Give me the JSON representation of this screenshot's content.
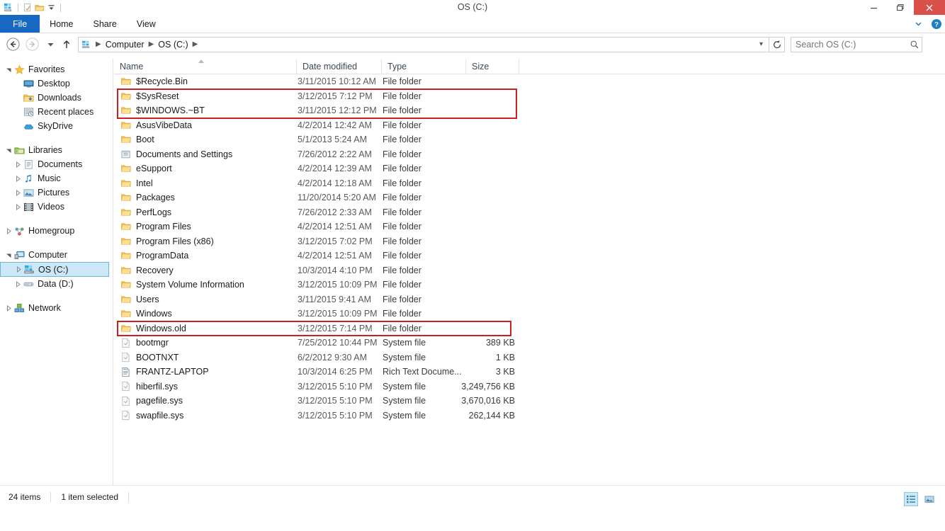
{
  "window": {
    "title": "OS (C:)",
    "quick_access": [
      "explorer-icon",
      "properties-icon",
      "new-folder-icon",
      "customize-dropdown-icon"
    ],
    "controls": {
      "minimize": "minimize-icon",
      "maximize": "restore-icon",
      "close": "close-icon"
    }
  },
  "ribbon": {
    "tabs": [
      {
        "label": "File",
        "active": true
      },
      {
        "label": "Home",
        "active": false
      },
      {
        "label": "Share",
        "active": false
      },
      {
        "label": "View",
        "active": false
      }
    ],
    "collapse_icon": "chevron-down-icon",
    "help_icon": "help-icon"
  },
  "address": {
    "back_icon": "back-arrow-icon",
    "forward_icon": "forward-arrow-icon",
    "history_icon": "recent-locations-icon",
    "up_icon": "up-arrow-icon",
    "breadcrumbs": [
      "Computer",
      "OS (C:)"
    ],
    "refresh_icon": "refresh-icon",
    "dropdown_icon": "chevron-down-icon"
  },
  "search": {
    "placeholder": "Search OS (C:)",
    "value": "",
    "icon": "search-icon"
  },
  "sidebar": {
    "groups": [
      {
        "header": {
          "label": "Favorites",
          "icon": "star-icon",
          "expander": "expanded"
        },
        "items": [
          {
            "label": "Desktop",
            "icon": "desktop-icon",
            "expander": "none"
          },
          {
            "label": "Downloads",
            "icon": "downloads-folder-icon",
            "expander": "none"
          },
          {
            "label": "Recent places",
            "icon": "recent-places-icon",
            "expander": "none"
          },
          {
            "label": "SkyDrive",
            "icon": "skydrive-cloud-icon",
            "expander": "none"
          }
        ]
      },
      {
        "header": {
          "label": "Libraries",
          "icon": "libraries-icon",
          "expander": "expanded"
        },
        "items": [
          {
            "label": "Documents",
            "icon": "documents-library-icon",
            "expander": "collapsed"
          },
          {
            "label": "Music",
            "icon": "music-note-icon",
            "expander": "collapsed"
          },
          {
            "label": "Pictures",
            "icon": "pictures-icon",
            "expander": "collapsed"
          },
          {
            "label": "Videos",
            "icon": "videos-icon",
            "expander": "collapsed"
          }
        ]
      },
      {
        "header": {
          "label": "Homegroup",
          "icon": "homegroup-icon",
          "expander": "collapsed"
        },
        "items": []
      },
      {
        "header": {
          "label": "Computer",
          "icon": "computer-icon",
          "expander": "expanded"
        },
        "items": [
          {
            "label": "OS (C:)",
            "icon": "hard-drive-icon",
            "expander": "collapsed",
            "selected": true
          },
          {
            "label": "Data (D:)",
            "icon": "disk-drive-icon",
            "expander": "collapsed"
          }
        ]
      },
      {
        "header": {
          "label": "Network",
          "icon": "network-icon",
          "expander": "collapsed"
        },
        "items": []
      }
    ]
  },
  "filelist": {
    "columns": [
      {
        "label": "Name",
        "sorted": "asc"
      },
      {
        "label": "Date modified",
        "sorted": "none"
      },
      {
        "label": "Type",
        "sorted": "none"
      },
      {
        "label": "Size",
        "sorted": "none"
      }
    ],
    "rows": [
      {
        "name": "$Recycle.Bin",
        "date": "3/11/2015 10:12 AM",
        "type": "File folder",
        "size": "",
        "icon": "folder-icon",
        "highlighted": false
      },
      {
        "name": "$SysReset",
        "date": "3/12/2015 7:12 PM",
        "type": "File folder",
        "size": "",
        "icon": "folder-icon",
        "highlighted": true
      },
      {
        "name": "$WINDOWS.~BT",
        "date": "3/11/2015 12:12 PM",
        "type": "File folder",
        "size": "",
        "icon": "folder-icon",
        "highlighted": true
      },
      {
        "name": "AsusVibeData",
        "date": "4/2/2014 12:42 AM",
        "type": "File folder",
        "size": "",
        "icon": "folder-icon",
        "highlighted": false
      },
      {
        "name": "Boot",
        "date": "5/1/2013 5:24 AM",
        "type": "File folder",
        "size": "",
        "icon": "folder-icon",
        "highlighted": false
      },
      {
        "name": "Documents and Settings",
        "date": "7/26/2012 2:22 AM",
        "type": "File folder",
        "size": "",
        "icon": "junction-folder-icon",
        "highlighted": false
      },
      {
        "name": "eSupport",
        "date": "4/2/2014 12:39 AM",
        "type": "File folder",
        "size": "",
        "icon": "folder-icon",
        "highlighted": false
      },
      {
        "name": "Intel",
        "date": "4/2/2014 12:18 AM",
        "type": "File folder",
        "size": "",
        "icon": "folder-icon",
        "highlighted": false
      },
      {
        "name": "Packages",
        "date": "11/20/2014 5:20 AM",
        "type": "File folder",
        "size": "",
        "icon": "folder-icon",
        "highlighted": false
      },
      {
        "name": "PerfLogs",
        "date": "7/26/2012 2:33 AM",
        "type": "File folder",
        "size": "",
        "icon": "folder-icon",
        "highlighted": false
      },
      {
        "name": "Program Files",
        "date": "4/2/2014 12:51 AM",
        "type": "File folder",
        "size": "",
        "icon": "folder-icon",
        "highlighted": false
      },
      {
        "name": "Program Files (x86)",
        "date": "3/12/2015 7:02 PM",
        "type": "File folder",
        "size": "",
        "icon": "folder-icon",
        "highlighted": false
      },
      {
        "name": "ProgramData",
        "date": "4/2/2014 12:51 AM",
        "type": "File folder",
        "size": "",
        "icon": "folder-icon",
        "highlighted": false
      },
      {
        "name": "Recovery",
        "date": "10/3/2014 4:10 PM",
        "type": "File folder",
        "size": "",
        "icon": "folder-icon",
        "highlighted": false
      },
      {
        "name": "System Volume Information",
        "date": "3/12/2015 10:09 PM",
        "type": "File folder",
        "size": "",
        "icon": "folder-icon",
        "highlighted": false
      },
      {
        "name": "Users",
        "date": "3/11/2015 9:41 AM",
        "type": "File folder",
        "size": "",
        "icon": "folder-icon",
        "highlighted": false
      },
      {
        "name": "Windows",
        "date": "3/12/2015 10:09 PM",
        "type": "File folder",
        "size": "",
        "icon": "folder-icon",
        "highlighted": false
      },
      {
        "name": "Windows.old",
        "date": "3/12/2015 7:14 PM",
        "type": "File folder",
        "size": "",
        "icon": "folder-icon",
        "highlighted": true
      },
      {
        "name": "bootmgr",
        "date": "7/25/2012 10:44 PM",
        "type": "System file",
        "size": "389 KB",
        "icon": "system-file-icon",
        "highlighted": false
      },
      {
        "name": "BOOTNXT",
        "date": "6/2/2012 9:30 AM",
        "type": "System file",
        "size": "1 KB",
        "icon": "system-file-icon",
        "highlighted": false
      },
      {
        "name": "FRANTZ-LAPTOP",
        "date": "10/3/2014 6:25 PM",
        "type": "Rich Text Docume...",
        "size": "3 KB",
        "icon": "rtf-document-icon",
        "highlighted": false
      },
      {
        "name": "hiberfil.sys",
        "date": "3/12/2015 5:10 PM",
        "type": "System file",
        "size": "3,249,756 KB",
        "icon": "system-file-icon",
        "highlighted": false
      },
      {
        "name": "pagefile.sys",
        "date": "3/12/2015 5:10 PM",
        "type": "System file",
        "size": "3,670,016 KB",
        "icon": "system-file-icon",
        "highlighted": false
      },
      {
        "name": "swapfile.sys",
        "date": "3/12/2015 5:10 PM",
        "type": "System file",
        "size": "262,144 KB",
        "icon": "system-file-icon",
        "highlighted": false
      }
    ]
  },
  "status": {
    "item_count": "24 items",
    "selection": "1 item selected",
    "view_buttons": [
      {
        "name": "details-view-icon",
        "active": true
      },
      {
        "name": "large-icons-view-icon",
        "active": false
      }
    ]
  },
  "colors": {
    "accent": "#1668c2",
    "close_button": "#d85049",
    "highlight_box": "#cc1f1f",
    "selection": "#cce8f6"
  }
}
